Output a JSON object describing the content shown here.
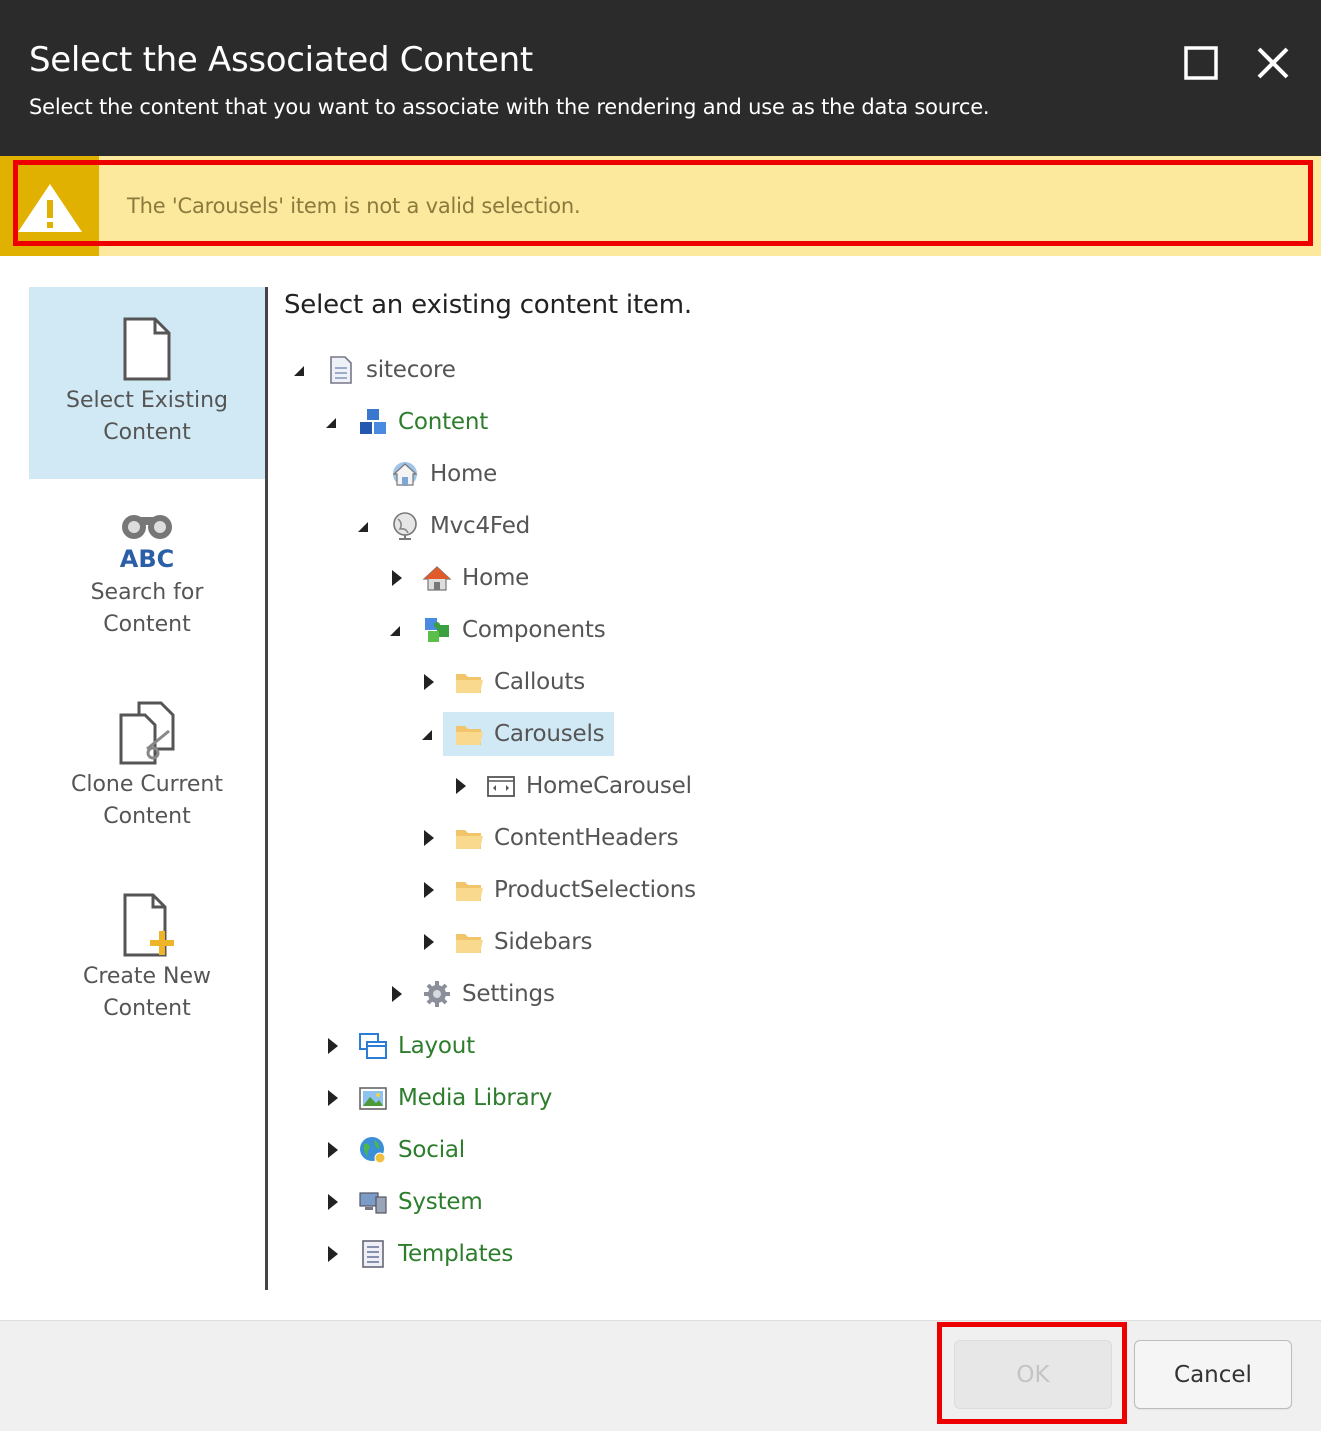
{
  "header": {
    "title": "Select the Associated Content",
    "subtitle": "Select the content that you want to associate with the rendering and use as the data source.",
    "icons": {
      "maximize": "maximize-icon",
      "close": "close-icon"
    }
  },
  "warning": {
    "text": "The 'Carousels' item is not a valid selection.",
    "icon": "warning-icon"
  },
  "sidebar": {
    "items": [
      {
        "line1": "Select Existing",
        "line2": "Content",
        "icon": "document-icon",
        "active": true
      },
      {
        "line1": "Search for",
        "line2": "Content",
        "icon": "binoculars-abc-icon",
        "active": false
      },
      {
        "line1": "Clone Current",
        "line2": "Content",
        "icon": "clone-documents-icon",
        "active": false
      },
      {
        "line1": "Create New",
        "line2": "Content",
        "icon": "new-document-icon",
        "active": false
      }
    ]
  },
  "main": {
    "heading": "Select an existing content item.",
    "tree": [
      {
        "label": "sitecore",
        "icon": "sitecore-page-icon",
        "expanded": true
      },
      {
        "label": "Content",
        "icon": "content-cubes-icon",
        "expanded": true
      },
      {
        "label": "Home",
        "icon": "home-globe-icon"
      },
      {
        "label": "Mvc4Fed",
        "icon": "globe-icon",
        "expanded": true
      },
      {
        "label": "Home",
        "icon": "house-icon",
        "expanded": false
      },
      {
        "label": "Components",
        "icon": "components-puzzle-icon",
        "expanded": true
      },
      {
        "label": "Callouts",
        "icon": "folder-icon",
        "expanded": false
      },
      {
        "label": "Carousels",
        "icon": "folder-icon",
        "expanded": true,
        "selected": true
      },
      {
        "label": "HomeCarousel",
        "icon": "carousel-icon",
        "expanded": false
      },
      {
        "label": "ContentHeaders",
        "icon": "folder-icon",
        "expanded": false
      },
      {
        "label": "ProductSelections",
        "icon": "folder-icon",
        "expanded": false
      },
      {
        "label": "Sidebars",
        "icon": "folder-icon",
        "expanded": false
      },
      {
        "label": "Settings",
        "icon": "gear-icon",
        "expanded": false
      },
      {
        "label": "Layout",
        "icon": "layout-windows-icon",
        "expanded": false
      },
      {
        "label": "Media Library",
        "icon": "media-picture-icon",
        "expanded": false
      },
      {
        "label": "Social",
        "icon": "social-globe-icon",
        "expanded": false
      },
      {
        "label": "System",
        "icon": "system-computer-icon",
        "expanded": false
      },
      {
        "label": "Templates",
        "icon": "templates-list-icon",
        "expanded": false
      }
    ]
  },
  "footer": {
    "ok_label": "OK",
    "cancel_label": "Cancel"
  },
  "colors": {
    "header_bg": "#2b2b2b",
    "warning_bg": "#fce99e",
    "warning_icon_bg": "#e0b100",
    "selection_bg": "#d1e9f5",
    "highlight_border": "#ee0000",
    "tree_green": "#2d7d2d"
  }
}
